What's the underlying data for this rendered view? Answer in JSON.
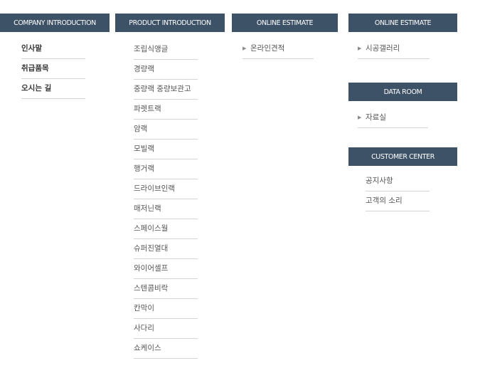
{
  "company": {
    "header": "COMPANY INTRODUCTION",
    "items": [
      "인사말",
      "취급품목",
      "오시는 길"
    ]
  },
  "product": {
    "header": "PRODUCT INTRODUCTION",
    "items": [
      "조립식앵글",
      "경량랙",
      "중량랙 중량보관고",
      "파렛트랙",
      "암랙",
      "모빌랙",
      "행거랙",
      "드라이브인랙",
      "매저닌랙",
      "스페이스월",
      "슈퍼진열대",
      "와이어셸프",
      "스텐콤비락",
      "칸막이",
      "사다리",
      "쇼케이스"
    ]
  },
  "estimate": {
    "header": "ONLINE ESTIMATE",
    "items": [
      "온라인견적"
    ]
  },
  "gallery": {
    "header": "ONLINE ESTIMATE",
    "items": [
      "시공갤러리"
    ]
  },
  "dataroom": {
    "header": "DATA ROOM",
    "items": [
      "자료실"
    ]
  },
  "customer": {
    "header": "CUSTOMER CENTER",
    "items": [
      "공지사항",
      "고객의 소리"
    ]
  },
  "icons": {
    "bullet": "small-triangle-arrow-icon"
  },
  "colors": {
    "header_bg": "#3d5266",
    "header_text": "#ffffff",
    "divider": "#d5d5d5",
    "item_text": "#555555"
  }
}
